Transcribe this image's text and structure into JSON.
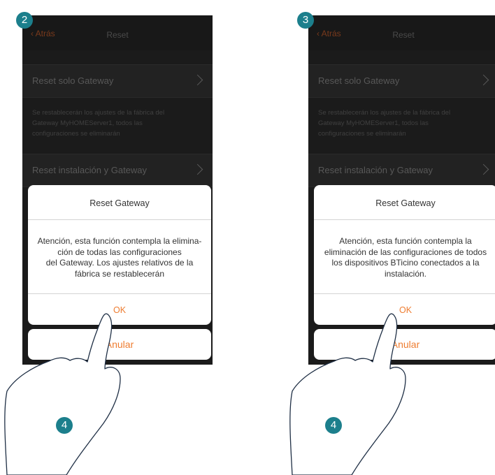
{
  "screens": [
    {
      "step": "2",
      "header": {
        "back_label": "Atrás",
        "title": "Reset"
      },
      "row1": {
        "label": "Reset solo Gateway"
      },
      "description": [
        "Se restablecerán los ajustes de la fábrica del",
        "Gateway MyHOMEServer1, todos las",
        "configuraciones se eliminarán"
      ],
      "row2": {
        "label": "Reset instalación y Gateway"
      },
      "dialog": {
        "title": "Reset Gateway",
        "message": [
          "Atención, esta función contempla la elimina-",
          "ción de todas las configuraciones",
          "del Gateway. Los ajustes relativos de la",
          "fábrica se restablecerán"
        ],
        "ok_label": "OK",
        "cancel_label": "Anular"
      },
      "touch_step": "4"
    },
    {
      "step": "3",
      "header": {
        "back_label": "Atrás",
        "title": "Reset"
      },
      "row1": {
        "label": "Reset solo Gateway"
      },
      "description": [
        "Se restablecerán los ajustes de la fábrica del",
        "Gateway MyHOMEServer1, todos las",
        "configuraciones se eliminarán"
      ],
      "row2": {
        "label": "Reset instalación y Gateway"
      },
      "dialog": {
        "title": "Reset Gateway",
        "message": [
          "Atención, esta función contempla la",
          "eliminación de las configuraciones de todos",
          "los dispositivos BTicino conectados a la",
          "instalación."
        ],
        "ok_label": "OK",
        "cancel_label": "Anular"
      },
      "touch_step": "4"
    }
  ],
  "colors": {
    "accent": "#ee7d31",
    "badge": "#1c7f8c",
    "screen_bg": "#1b1b1b"
  },
  "icons": {
    "back": "chevron-left-icon",
    "row": "chevron-right-icon",
    "touch": "hand-tap-icon"
  }
}
